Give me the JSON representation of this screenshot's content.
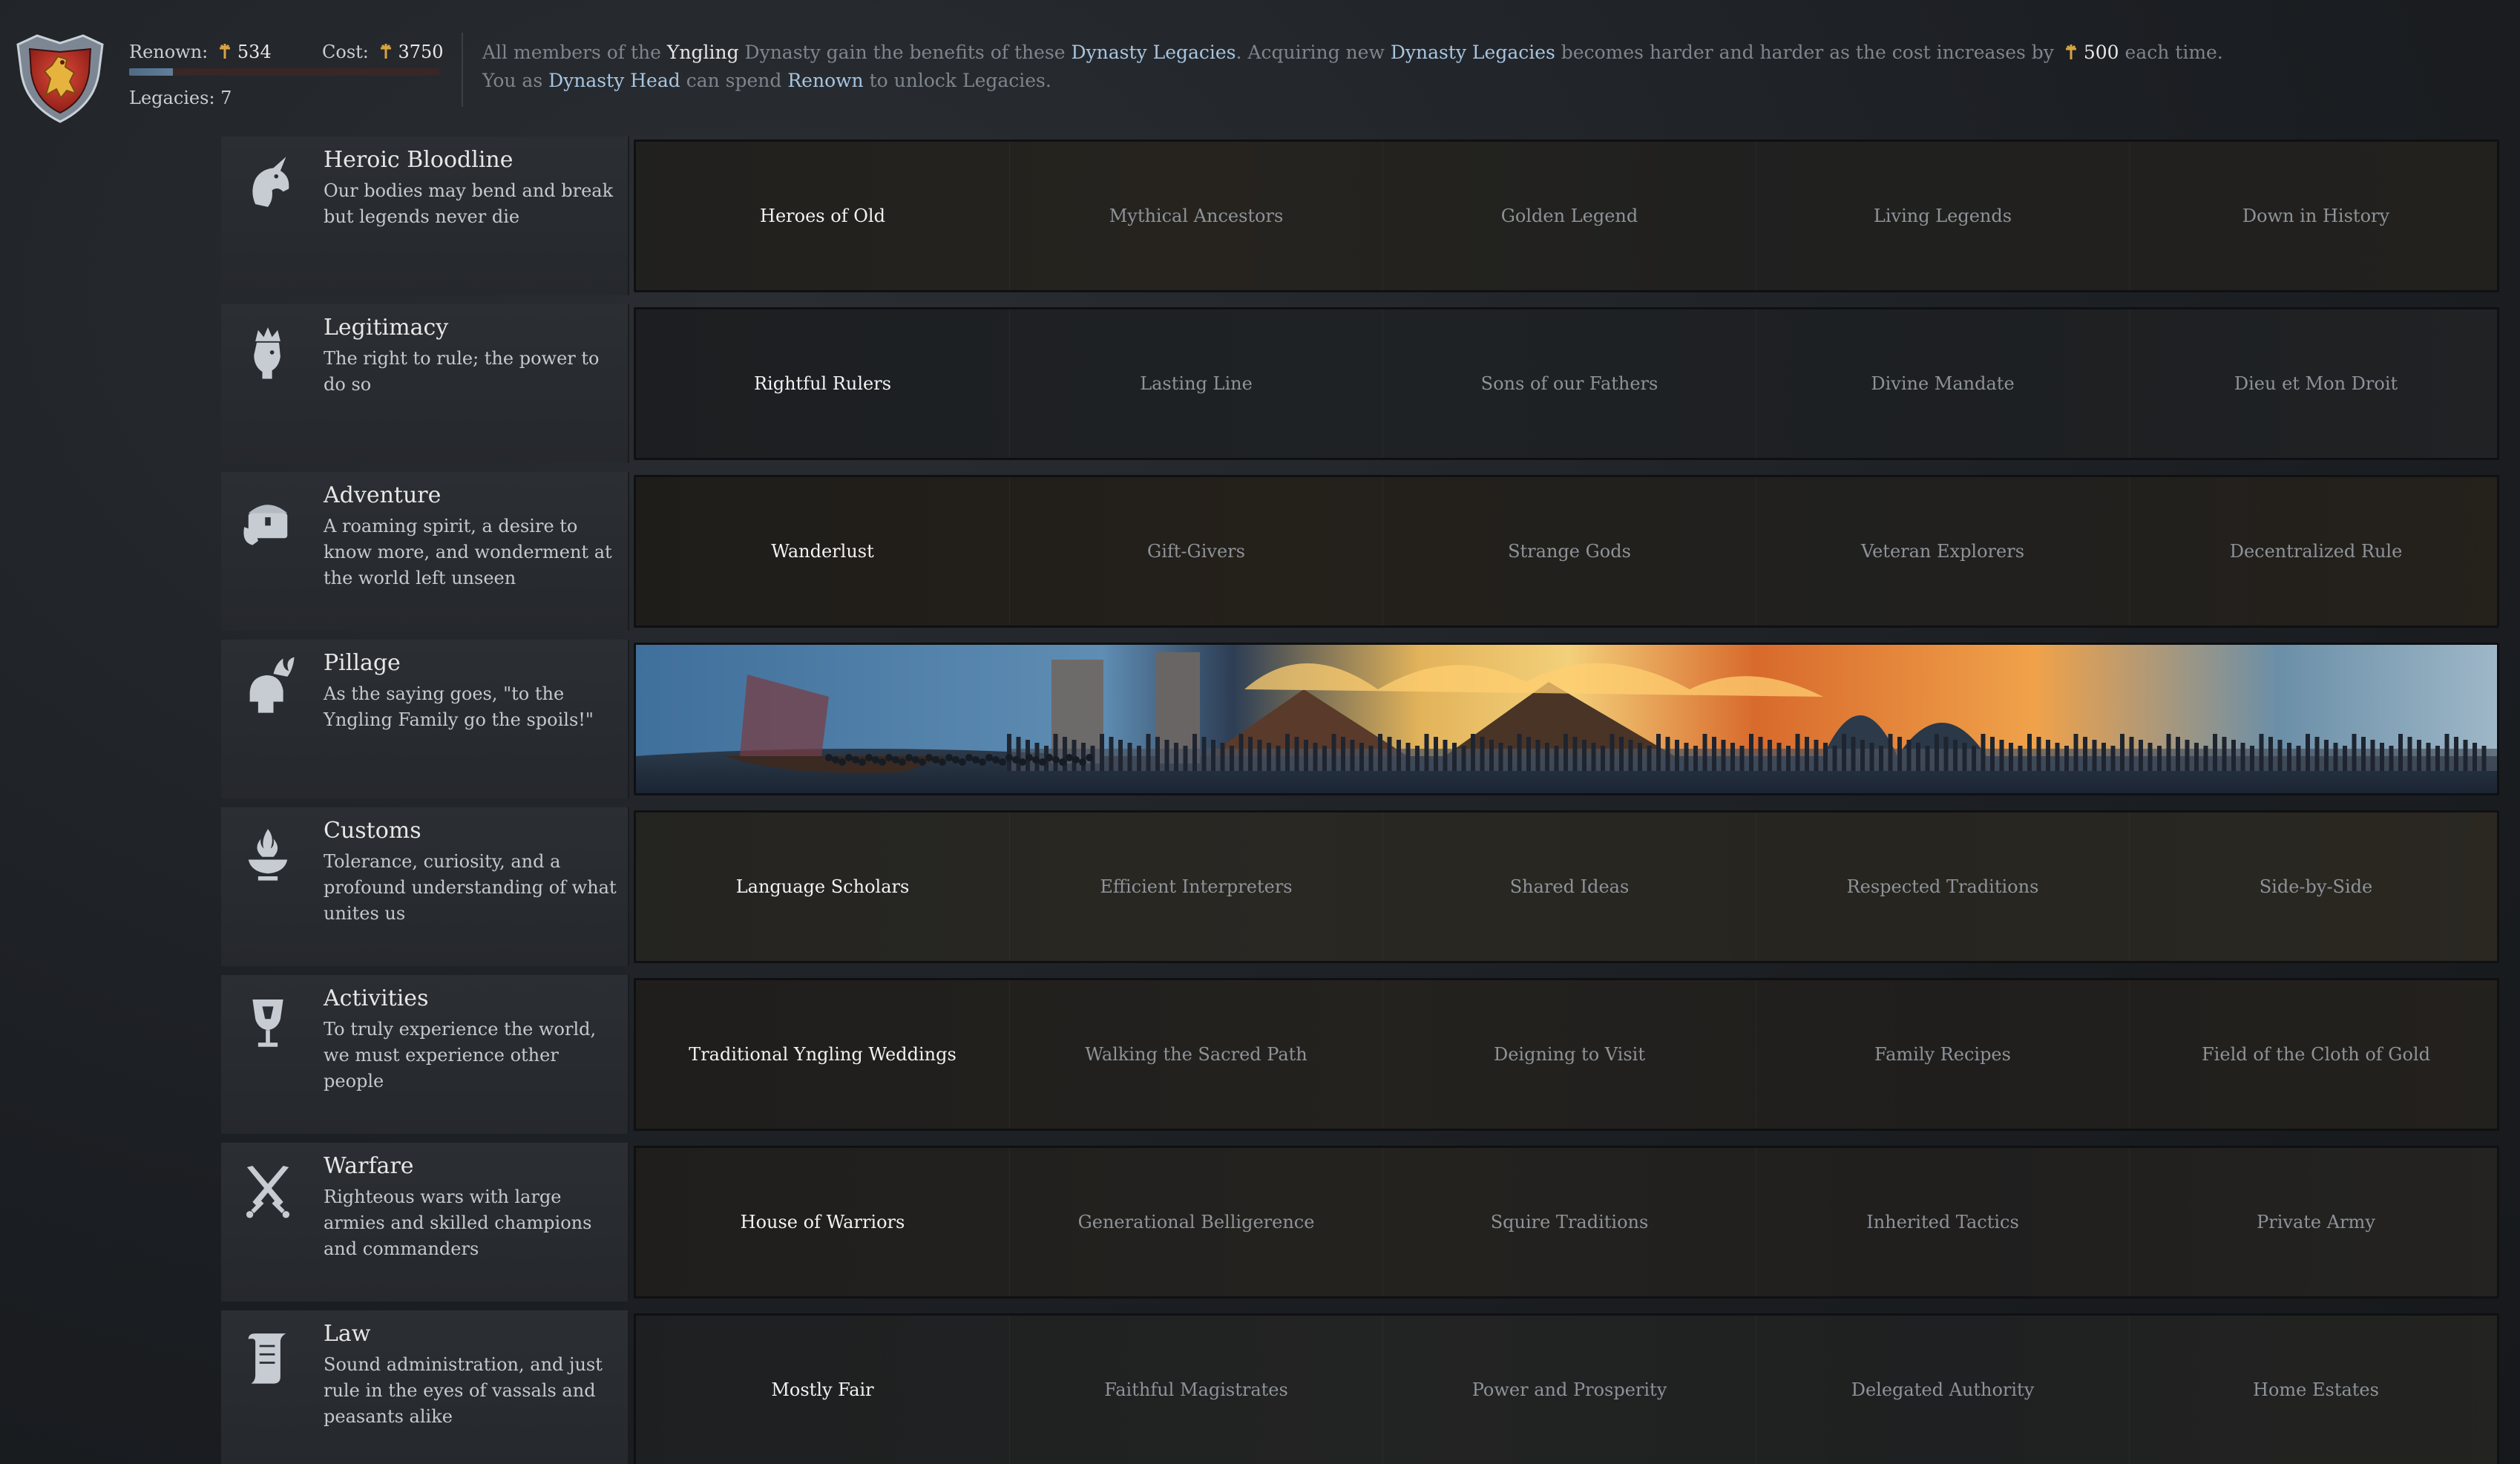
{
  "header": {
    "renown_label": "Renown:",
    "renown_value": "534",
    "cost_label": "Cost:",
    "cost_value": "3750",
    "legacies_text": "Legacies: 7",
    "renown_progress": 0.14,
    "info_line1": {
      "p1": "All members of the ",
      "dynasty": "Yngling",
      "p2": " Dynasty gain the benefits of these ",
      "dl1": "Dynasty Legacies",
      "p3": ". Acquiring new ",
      "dl2": "Dynasty Legacies",
      "p4": " becomes harder and harder as the cost increases by ",
      "amount": "500",
      "p5": " each time."
    },
    "info_line2": {
      "p1": "You as ",
      "head": "Dynasty Head",
      "p2": " can spend ",
      "renown": "Renown",
      "p3": " to unlock Legacies."
    }
  },
  "legacy_tracks": [
    {
      "title": "Heroic Bloodline",
      "description": "Our bodies may bend and break but legends never die",
      "icon": "unicorn-icon",
      "unlocked": false,
      "legacies": [
        "Heroes of Old",
        "Mythical Ancestors",
        "Golden Legend",
        "Living Legends",
        "Down in History"
      ]
    },
    {
      "title": "Legitimacy",
      "description": "The right to rule; the power to do so",
      "icon": "crowned-head-icon",
      "unlocked": false,
      "legacies": [
        "Rightful Rulers",
        "Lasting Line",
        "Sons of our Fathers",
        "Divine Mandate",
        "Dieu et Mon Droit"
      ]
    },
    {
      "title": "Adventure",
      "description": "A roaming spirit, a desire to know more, and wonderment at the world left unseen",
      "icon": "chest-icon",
      "unlocked": false,
      "legacies": [
        "Wanderlust",
        "Gift-Givers",
        "Strange Gods",
        "Veteran Explorers",
        "Decentralized Rule"
      ]
    },
    {
      "title": "Pillage",
      "description": "As the saying goes, \"to the Yngling Family go the spoils!\"",
      "icon": "fire-helmet-icon",
      "unlocked": true,
      "legacies": []
    },
    {
      "title": "Customs",
      "description": "Tolerance, curiosity, and a profound understanding of what unites us",
      "icon": "flame-bowl-icon",
      "unlocked": false,
      "legacies": [
        "Language Scholars",
        "Efficient Interpreters",
        "Shared Ideas",
        "Respected Traditions",
        "Side-by-Side"
      ]
    },
    {
      "title": "Activities",
      "description": "To truly experience the world, we must experience other people",
      "icon": "goblet-icon",
      "unlocked": false,
      "legacies": [
        "Traditional Yngling Weddings",
        "Walking the Sacred Path",
        "Deigning to Visit",
        "Family Recipes",
        "Field of the Cloth of Gold"
      ]
    },
    {
      "title": "Warfare",
      "description": "Righteous wars with large armies and skilled champions and commanders",
      "icon": "crossed-swords-icon",
      "unlocked": false,
      "legacies": [
        "House of Warriors",
        "Generational Belligerence",
        "Squire Traditions",
        "Inherited Tactics",
        "Private Army"
      ]
    },
    {
      "title": "Law",
      "description": "Sound administration, and just rule in the eyes of vassals and peasants alike",
      "icon": "scroll-icon",
      "unlocked": false,
      "legacies": [
        "Mostly Fair",
        "Faithful Magistrates",
        "Power and Prosperity",
        "Delegated Authority",
        "Home Estates"
      ]
    }
  ],
  "colors": {
    "accent_text": "#a7c5e0",
    "active_legacy": "#f2f2f2",
    "inactive_legacy": "#8e9399",
    "crest_red": "#c3362b",
    "crest_gold": "#e7b33f"
  }
}
